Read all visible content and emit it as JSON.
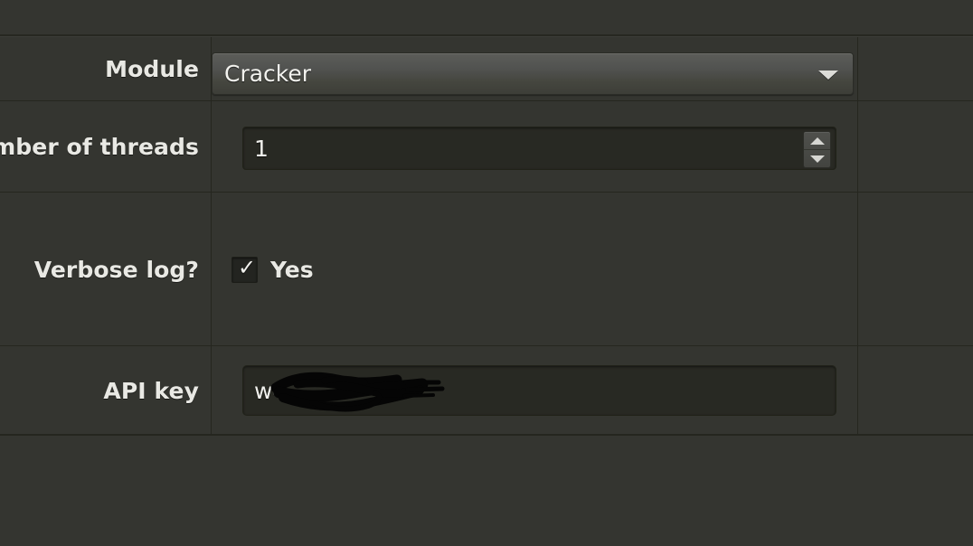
{
  "window": {
    "background_color": "#343530",
    "panel_color": "#3a3b36",
    "divider_color": "#25261f",
    "text_color": "#e9e9e4"
  },
  "form": {
    "rows": [
      {
        "label": "Module",
        "control": "combobox",
        "value": "Cracker",
        "arrow_icon": "chevron-down-icon"
      },
      {
        "label": "Number of threads",
        "label_clipped": "mber of threads",
        "control": "spinbox",
        "value": "1",
        "up_icon": "triangle-up-icon",
        "down_icon": "triangle-down-icon"
      },
      {
        "label": "Verbose log?",
        "control": "checkbox",
        "checked": true,
        "check_glyph": "✓",
        "checkbox_label": "Yes"
      },
      {
        "label": "API key",
        "control": "textfield",
        "value": "w4",
        "redacted": true,
        "redaction_color": "#000000"
      }
    ]
  }
}
